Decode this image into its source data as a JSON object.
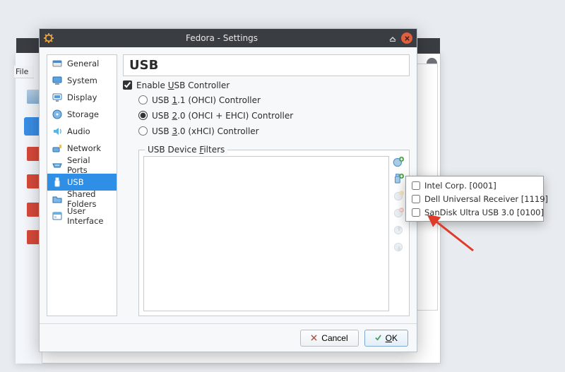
{
  "bg": {
    "file_menu": "File"
  },
  "dialog": {
    "title": "Fedora - Settings",
    "sidebar": {
      "items": [
        {
          "label": "General"
        },
        {
          "label": "System"
        },
        {
          "label": "Display"
        },
        {
          "label": "Storage"
        },
        {
          "label": "Audio"
        },
        {
          "label": "Network"
        },
        {
          "label": "Serial Ports"
        },
        {
          "label": "USB"
        },
        {
          "label": "Shared Folders"
        },
        {
          "label": "User Interface"
        }
      ]
    },
    "heading": "USB",
    "enable_checkbox_pre": "Enable ",
    "enable_checkbox_mn": "U",
    "enable_checkbox_post": "SB Controller",
    "radios": {
      "r1_pre": "USB ",
      "r1_mn": "1",
      "r1_post": ".1 (OHCI) Controller",
      "r2_pre": "USB ",
      "r2_mn": "2",
      "r2_post": ".0 (OHCI + EHCI) Controller",
      "r3_pre": "USB ",
      "r3_mn": "3",
      "r3_post": ".0 (xHCI) Controller"
    },
    "filters_label_pre": "USB Device ",
    "filters_label_mn": "F",
    "filters_label_post": "ilters",
    "footer": {
      "cancel": "Cancel",
      "ok_mn": "O",
      "ok_post": "K"
    }
  },
  "popup": {
    "items": [
      {
        "label": "Intel Corp.  [0001]"
      },
      {
        "label": "Dell Universal Receiver [1119]"
      },
      {
        "label": "SanDisk Ultra USB 3.0 [0100]"
      }
    ]
  }
}
